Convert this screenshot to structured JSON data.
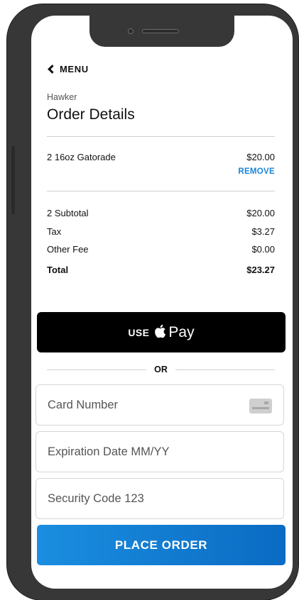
{
  "nav": {
    "back_label": "MENU"
  },
  "header": {
    "vendor": "Hawker",
    "title": "Order Details"
  },
  "cart": {
    "items": [
      {
        "name": "2 16oz Gatorade",
        "price": "$20.00",
        "remove_label": "REMOVE"
      }
    ]
  },
  "summary": {
    "subtotal_label": "2 Subtotal",
    "subtotal_value": "$20.00",
    "tax_label": "Tax",
    "tax_value": "$3.27",
    "fee_label": "Other Fee",
    "fee_value": "$0.00",
    "total_label": "Total",
    "total_value": "$23.27"
  },
  "apple_pay": {
    "prefix": "USE",
    "suffix": "Pay",
    "icon": "apple-logo-icon"
  },
  "divider": {
    "label": "OR"
  },
  "payment_form": {
    "card_number_placeholder": "Card Number",
    "card_icon": "credit-card-icon",
    "expiration_placeholder": "Expiration Date MM/YY",
    "security_placeholder": "Security Code 123"
  },
  "actions": {
    "place_order_label": "PLACE ORDER"
  },
  "colors": {
    "accent": "#1A86D8",
    "button_gradient_start": "#1A8EE0",
    "button_gradient_end": "#0A6BC3",
    "apple_pay_bg": "#000000",
    "device_frame": "#373737"
  }
}
